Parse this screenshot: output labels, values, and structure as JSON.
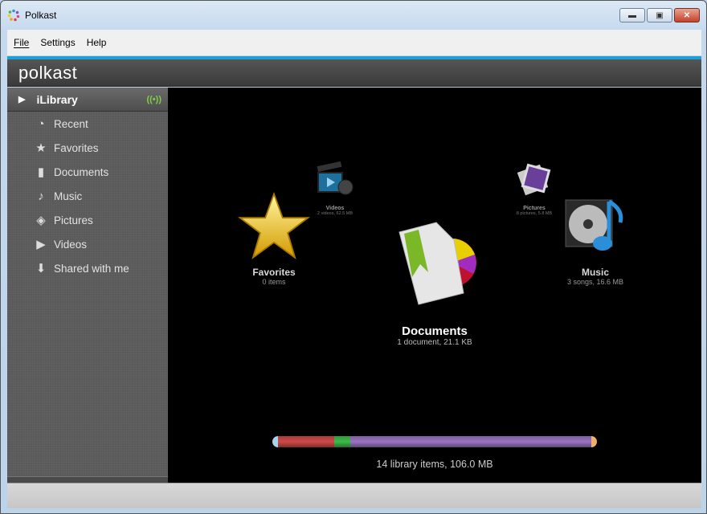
{
  "window": {
    "title": "Polkast",
    "controls": [
      "minimize",
      "maximize",
      "close"
    ]
  },
  "menu": [
    {
      "label": "File",
      "accel": "F"
    },
    {
      "label": "Settings",
      "accel": "S"
    },
    {
      "label": "Help",
      "accel": "H"
    }
  ],
  "brand": "polkast",
  "sidebar": {
    "header": "iLibrary",
    "status_icon": "broadcast-icon",
    "items": [
      {
        "label": "Recent",
        "icon": "clock-icon"
      },
      {
        "label": "Favorites",
        "icon": "star-icon"
      },
      {
        "label": "Documents",
        "icon": "document-icon"
      },
      {
        "label": "Music",
        "icon": "music-note-icon"
      },
      {
        "label": "Pictures",
        "icon": "pictures-icon"
      },
      {
        "label": "Videos",
        "icon": "video-clapper-icon"
      },
      {
        "label": "Shared with me",
        "icon": "download-icon"
      }
    ]
  },
  "library": {
    "favorites": {
      "title": "Favorites",
      "subtitle": "0 items"
    },
    "videos": {
      "title": "Videos",
      "subtitle": "2 videos, 62.5 MB"
    },
    "documents": {
      "title": "Documents",
      "subtitle": "1 document, 21.1 KB"
    },
    "pictures": {
      "title": "Pictures",
      "subtitle": "8 pictures, 5.8 MB"
    },
    "music": {
      "title": "Music",
      "subtitle": "3 songs, 16.6 MB"
    }
  },
  "storage_bar": {
    "summary": "14 library items, 106.0 MB",
    "segments": [
      {
        "color": "#d04a4a",
        "fraction": 0.18
      },
      {
        "color": "#3dbb4a",
        "fraction": 0.05
      },
      {
        "color": "#9a74c2",
        "fraction": 0.77
      }
    ],
    "cap_left_color": "#a9d4ee",
    "cap_right_color": "#f2b06a"
  }
}
